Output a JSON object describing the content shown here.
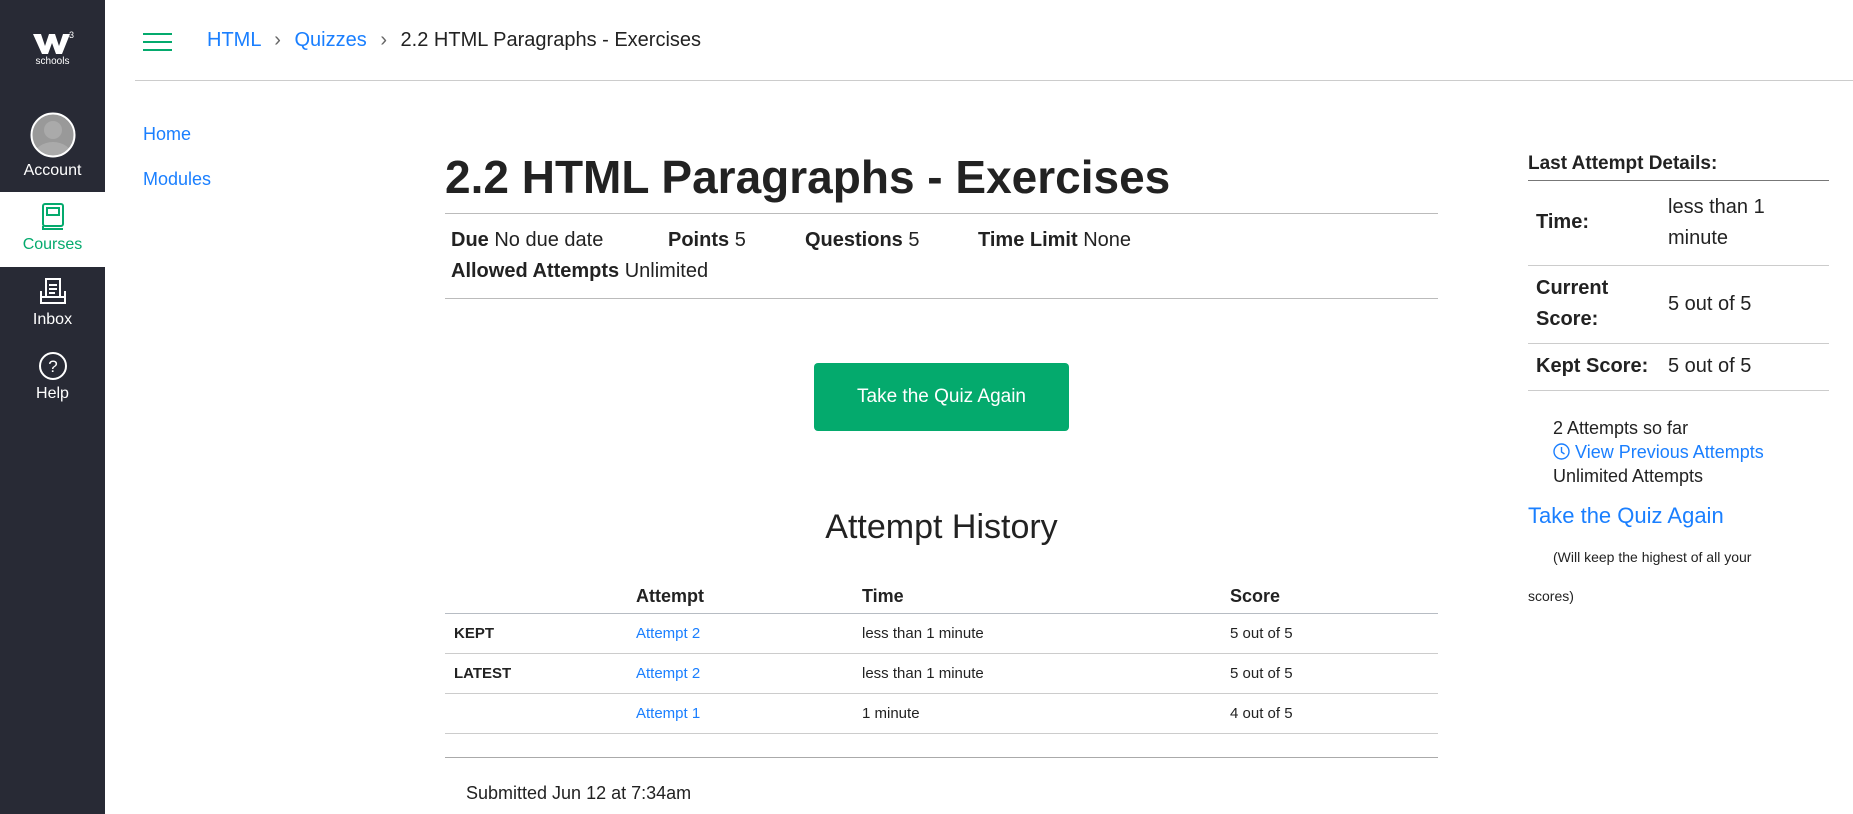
{
  "sidebar": {
    "logo_text": "schools",
    "items": [
      {
        "label": "Account"
      },
      {
        "label": "Courses"
      },
      {
        "label": "Inbox"
      },
      {
        "label": "Help"
      }
    ]
  },
  "breadcrumb": [
    "HTML",
    "Quizzes",
    "2.2 HTML Paragraphs - Exercises"
  ],
  "left_nav": [
    "Home",
    "Modules"
  ],
  "quiz": {
    "title": "2.2 HTML Paragraphs - Exercises",
    "meta": [
      {
        "label": "Due",
        "value": "No due date"
      },
      {
        "label": "Points",
        "value": "5"
      },
      {
        "label": "Questions",
        "value": "5"
      },
      {
        "label": "Time Limit",
        "value": "None"
      },
      {
        "label": "Allowed Attempts",
        "value": "Unlimited"
      }
    ],
    "take_again_label": "Take the Quiz Again"
  },
  "history": {
    "title": "Attempt History",
    "columns": [
      "",
      "Attempt",
      "Time",
      "Score"
    ],
    "rows": [
      {
        "tag": "KEPT",
        "attempt": "Attempt 2",
        "time": "less than 1 minute",
        "score": "5 out of 5"
      },
      {
        "tag": "LATEST",
        "attempt": "Attempt 2",
        "time": "less than 1 minute",
        "score": "5 out of 5"
      },
      {
        "tag": "",
        "attempt": "Attempt 1",
        "time": "1 minute",
        "score": "4 out of 5"
      }
    ],
    "submitted": "Submitted Jun 12 at 7:34am"
  },
  "last_attempt": {
    "heading": "Last Attempt Details:",
    "rows": [
      {
        "label": "Time:",
        "value": "less than 1 minute"
      },
      {
        "label": "Current Score:",
        "value": "5 out of 5"
      },
      {
        "label": "Kept Score:",
        "value": "5 out of 5"
      }
    ],
    "attempts_so_far": "2 Attempts so far",
    "view_previous": "View Previous Attempts",
    "unlimited": "Unlimited Attempts",
    "take_again": "Take the Quiz Again",
    "note": "(Will keep the highest of all your scores)"
  },
  "colors": {
    "accent": "#04AA6D",
    "link": "#1A7FFF",
    "sidebar": "#282A35"
  }
}
